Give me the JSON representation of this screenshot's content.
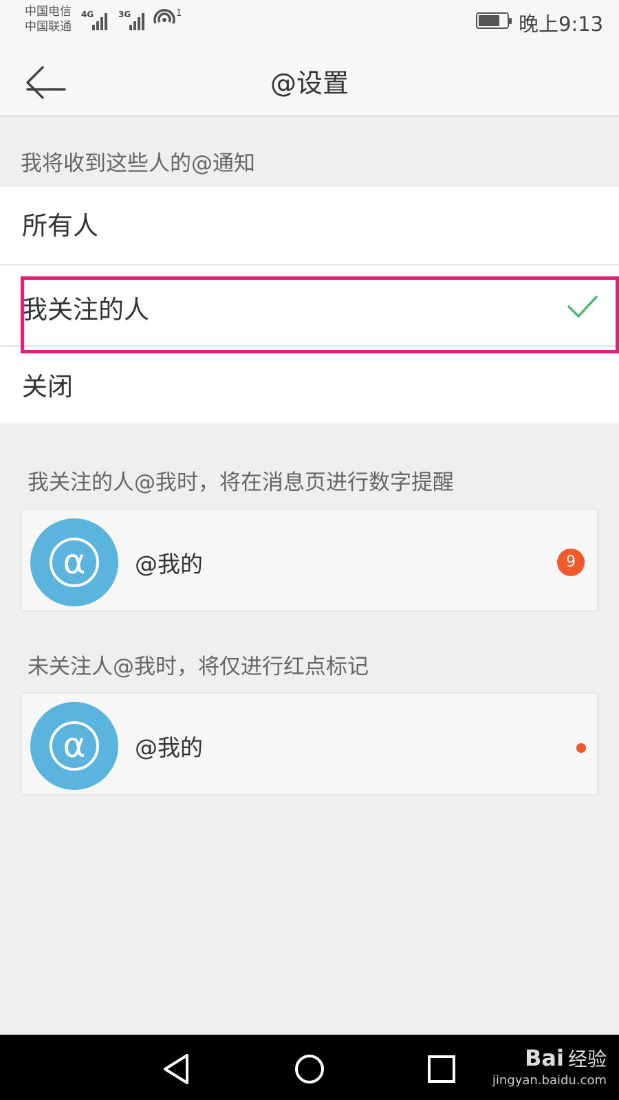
{
  "status_bar": {
    "carrier_1": "中国电信",
    "carrier_2": "中国联通",
    "network_1": "4G",
    "network_2": "3G",
    "hotspot_count": "1",
    "battery_level": 0.75,
    "time": "晚上9:13"
  },
  "header": {
    "back_icon": "arrow-left-icon",
    "title": "@设置"
  },
  "notify_section": {
    "label": "我将收到这些人的@通知",
    "options": [
      {
        "label": "所有人",
        "selected": false
      },
      {
        "label": "我关注的人",
        "selected": true
      },
      {
        "label": "关闭",
        "selected": false
      }
    ],
    "check_icon": "checkmark-icon",
    "highlight_color": "#e1207a"
  },
  "followed_section": {
    "description": "我关注的人@我时，将在消息页进行数字提醒",
    "card_label": "@我的",
    "badge_count": "9"
  },
  "unfollowed_section": {
    "description": "未关注人@我时，将仅进行红点标记",
    "card_label": "@我的"
  },
  "nav_bar": {
    "back_icon": "triangle-back-icon",
    "home_icon": "circle-home-icon",
    "recents_icon": "square-recents-icon"
  },
  "watermark": {
    "brand": "Bai",
    "brand_cn": "经验",
    "url": "jingyan.baidu.com"
  },
  "colors": {
    "accent_blue": "#5ab4dd",
    "badge_red": "#f05a2b",
    "check_green": "#4cbb6c"
  }
}
